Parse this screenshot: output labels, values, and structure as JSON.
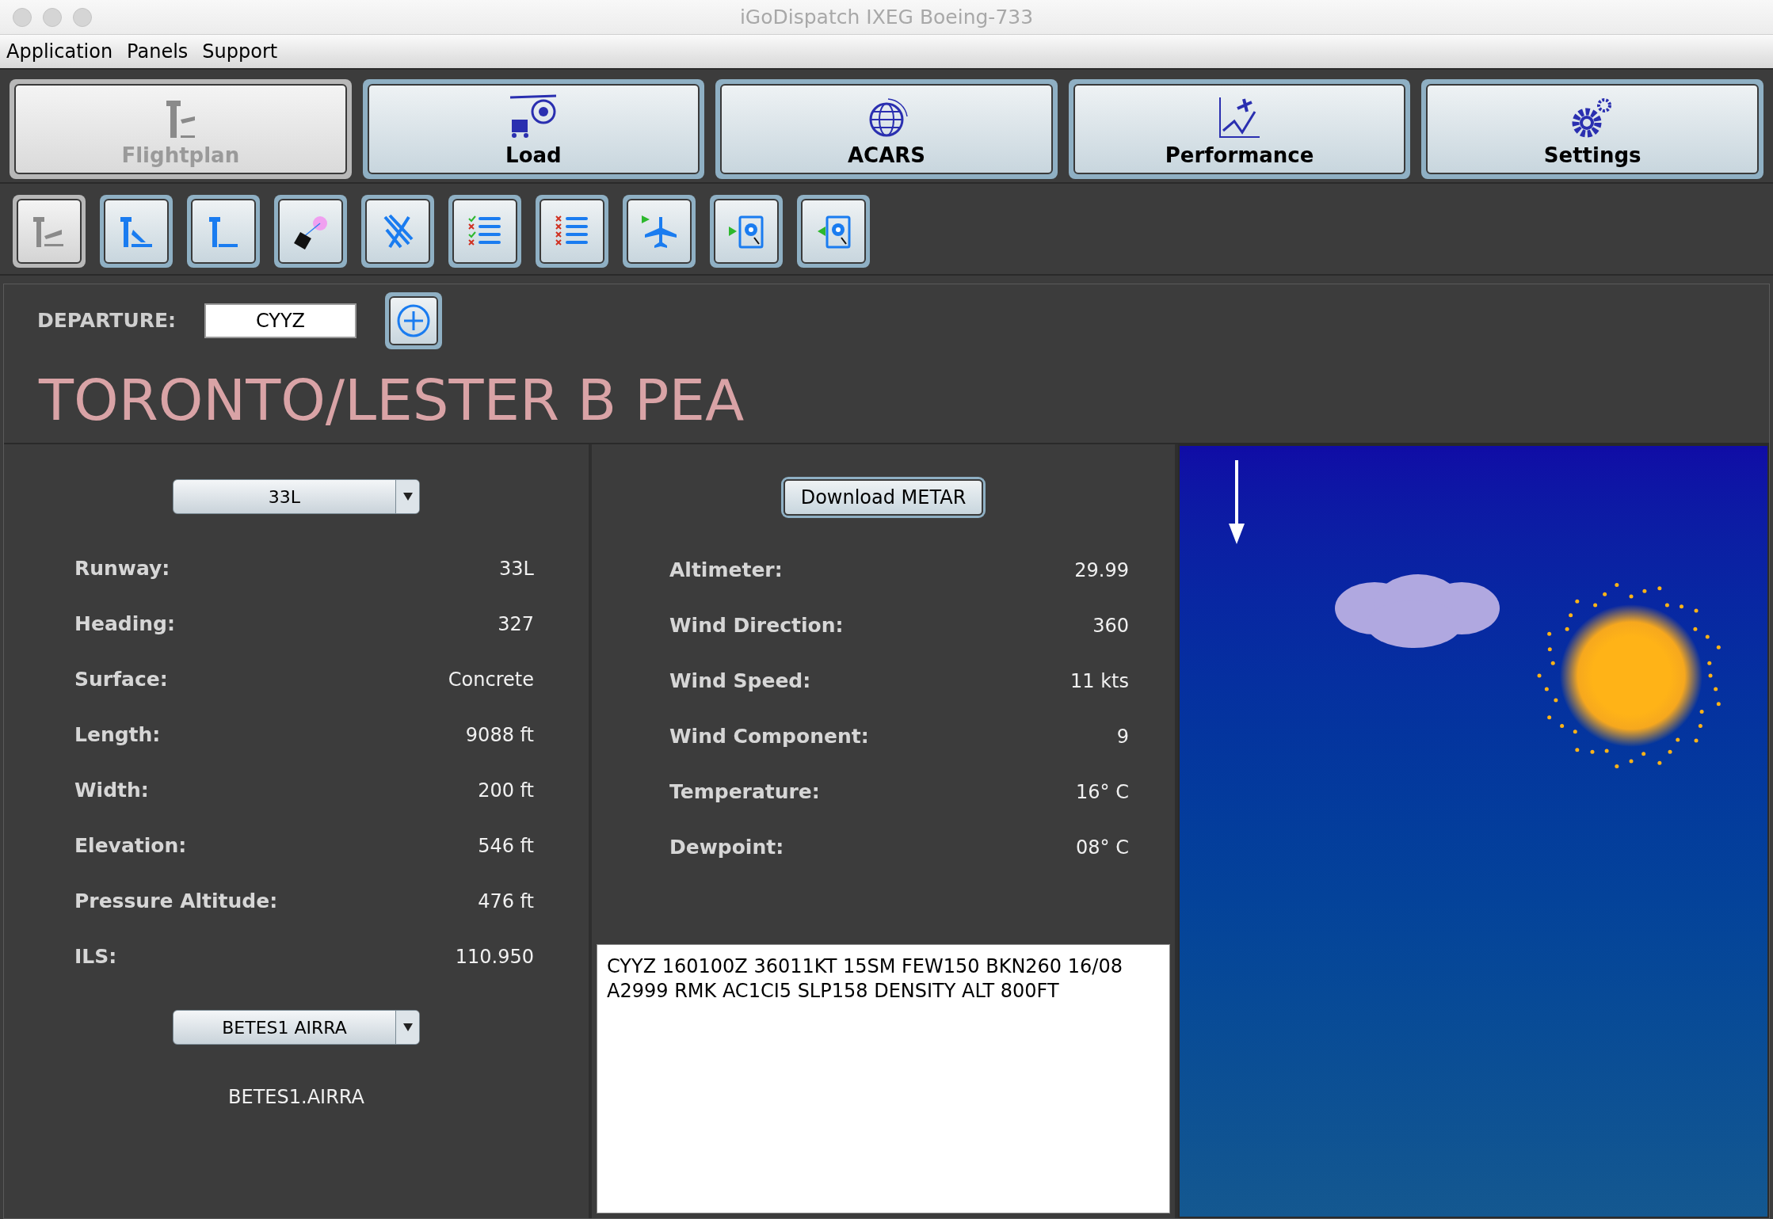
{
  "window": {
    "title": "iGoDispatch IXEG Boeing-733"
  },
  "menu": [
    "Application",
    "Panels",
    "Support"
  ],
  "tabs": [
    {
      "label": "Flightplan",
      "selected": true
    },
    {
      "label": "Load",
      "selected": false
    },
    {
      "label": "ACARS",
      "selected": false
    },
    {
      "label": "Performance",
      "selected": false
    },
    {
      "label": "Settings",
      "selected": false
    }
  ],
  "toolbar": [
    {
      "selected": true
    },
    {
      "selected": false
    },
    {
      "selected": false
    },
    {
      "selected": false
    },
    {
      "selected": false
    },
    {
      "selected": false
    },
    {
      "selected": false
    },
    {
      "selected": false
    },
    {
      "selected": false
    },
    {
      "selected": false
    }
  ],
  "departure": {
    "label": "DEPARTURE:",
    "value": "CYYZ"
  },
  "airport_name": "TORONTO/LESTER B PEA",
  "runway_select": "33L",
  "runway_info": [
    {
      "label": "Runway:",
      "value": "33L"
    },
    {
      "label": "Heading:",
      "value": "327"
    },
    {
      "label": "Surface:",
      "value": "Concrete"
    },
    {
      "label": "Length:",
      "value": "9088 ft"
    },
    {
      "label": "Width:",
      "value": "200 ft"
    },
    {
      "label": "Elevation:",
      "value": "546 ft"
    },
    {
      "label": "Pressure Altitude:",
      "value": "476 ft"
    },
    {
      "label": "ILS:",
      "value": "110.950"
    }
  ],
  "sid_select": "BETES1 AIRRA",
  "sid_text": "BETES1.AIRRA",
  "download_button": "Download METAR",
  "weather": [
    {
      "label": "Altimeter:",
      "value": "29.99"
    },
    {
      "label": "Wind Direction:",
      "value": "360"
    },
    {
      "label": "Wind Speed:",
      "value": "11 kts"
    },
    {
      "label": "Wind Component:",
      "value": "9"
    },
    {
      "label": "Temperature:",
      "value": "16° C"
    },
    {
      "label": "Dewpoint:",
      "value": "08° C"
    }
  ],
  "metar": "CYYZ 160100Z 36011KT 15SM FEW150 BKN260 16/08 A2999 RMK AC1CI5 SLP158 DENSITY ALT 800FT"
}
